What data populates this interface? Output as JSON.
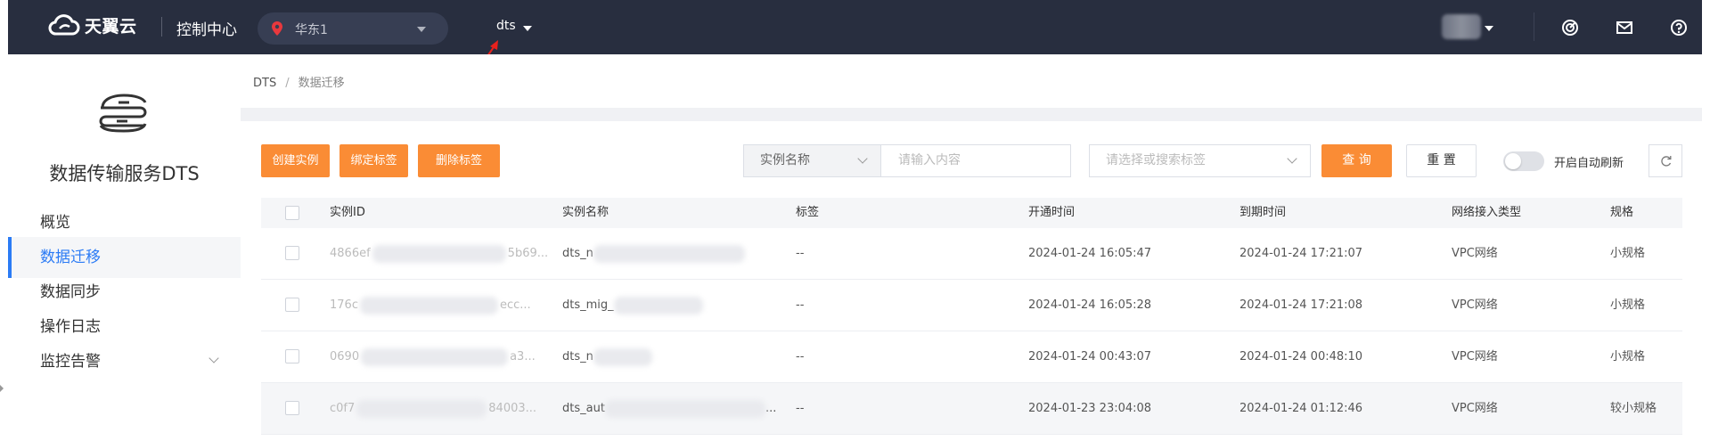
{
  "topbar": {
    "brand": "天翼云",
    "console_title": "控制中心",
    "region": "华东1",
    "product": "dts"
  },
  "breadcrumb": {
    "root": "DTS",
    "current": "数据迁移"
  },
  "sidebar": {
    "title": "数据传输服务DTS",
    "items": [
      {
        "label": "概览"
      },
      {
        "label": "数据迁移"
      },
      {
        "label": "数据同步"
      },
      {
        "label": "操作日志"
      },
      {
        "label": "监控告警"
      }
    ]
  },
  "toolbar": {
    "create": "创建实例",
    "bind_tag": "绑定标签",
    "remove_tag": "删除标签",
    "filter_field": "实例名称",
    "input_placeholder": "请输入内容",
    "tag_placeholder": "请选择或搜索标签",
    "query": "查 询",
    "reset": "重 置",
    "auto_refresh": "开启自动刷新"
  },
  "table": {
    "headers": [
      "实例ID",
      "实例名称",
      "标签",
      "开通时间",
      "到期时间",
      "网络接入类型",
      "规格"
    ],
    "rows": [
      {
        "id_start": "4866ef",
        "id_end": "5b69...",
        "name": "dts_n",
        "tag": "--",
        "open": "2024-01-24 16:05:47",
        "expire": "2024-01-24 17:21:07",
        "network": "VPC网络",
        "spec": "小规格"
      },
      {
        "id_start": "176c",
        "id_end": "ecc...",
        "name": "dts_mig_",
        "tag": "--",
        "open": "2024-01-24 16:05:28",
        "expire": "2024-01-24 17:21:08",
        "network": "VPC网络",
        "spec": "小规格"
      },
      {
        "id_start": "0690",
        "id_end": "a3...",
        "name": "dts_n",
        "tag": "--",
        "open": "2024-01-24 00:43:07",
        "expire": "2024-01-24 00:48:10",
        "network": "VPC网络",
        "spec": "小规格"
      },
      {
        "id_start": "c0f7",
        "id_end": "84003...",
        "name": "dts_aut",
        "name_end": "...",
        "tag": "--",
        "open": "2024-01-23 23:04:08",
        "expire": "2024-01-24 01:12:46",
        "network": "VPC网络",
        "spec": "较小规格"
      }
    ]
  },
  "colors": {
    "accent": "#fa8c35",
    "active_nav": "#2b7bf5",
    "topbar": "#282e3f"
  }
}
